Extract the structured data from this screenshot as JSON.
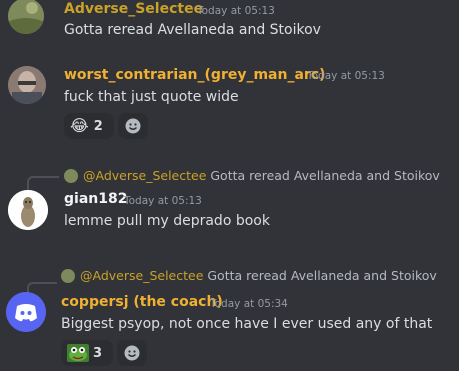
{
  "messages": [
    {
      "username": "Adverse_Selectee",
      "timestamp": "Today at 05:13",
      "text": "Gotta reread Avellaneda and Stoikov"
    },
    {
      "username": "worst_contrarian_(grey_man_arc)",
      "timestamp": "Today at 05:13",
      "text": "fuck that just quote wide",
      "reaction": {
        "emoji": "😂",
        "count": "2"
      }
    },
    {
      "reply_to": {
        "username": "@Adverse_Selectee",
        "text": "Gotta reread Avellaneda and Stoikov"
      },
      "username": "gian182",
      "timestamp": "Today at 05:13",
      "text": "lemme pull my deprado book"
    },
    {
      "reply_to": {
        "username": "@Adverse_Selectee",
        "text": "Gotta reread Avellaneda and Stoikov"
      },
      "username": "coppersj (the coach)",
      "timestamp": "Today at 05:34",
      "text": "Biggest psyop, not once have I ever used any of that",
      "reaction": {
        "emoji": "frog-emoji",
        "count": "3"
      }
    }
  ],
  "colors": {
    "background": "#313338",
    "username_gold": "#f0b132",
    "username_white": "#f2f3f5",
    "timestamp": "#949ba4",
    "reaction_bg": "#2b2d31",
    "discord_blurple": "#5865f2"
  }
}
